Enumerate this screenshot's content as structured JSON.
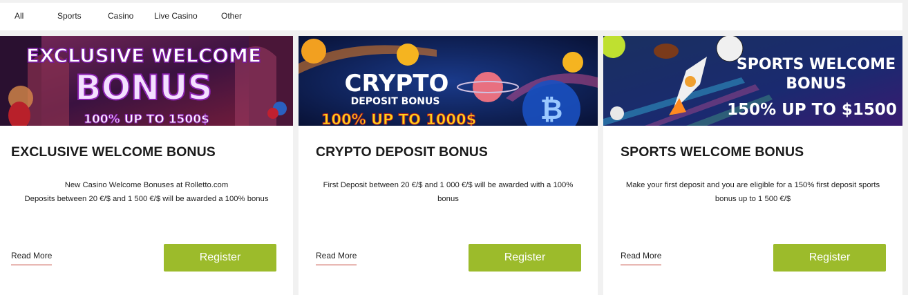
{
  "tabs": [
    {
      "label": "All"
    },
    {
      "label": "Sports"
    },
    {
      "label": "Casino"
    },
    {
      "label": "Live Casino"
    },
    {
      "label": "Other"
    }
  ],
  "cards": [
    {
      "banner": {
        "line1": "EXCLUSIVE WELCOME",
        "line2": "BONUS",
        "line3": "100% UP TO 1500$"
      },
      "title": "EXCLUSIVE WELCOME BONUS",
      "desc": [
        "New Casino Welcome Bonuses at Rolletto.com",
        "Deposits between 20 €/$ and 1 500 €/$ will be awarded a 100% bonus"
      ],
      "read_more": "Read More",
      "register": "Register"
    },
    {
      "banner": {
        "line1": "CRYPTO",
        "line2": "DEPOSIT BONUS",
        "line3": "100% UP TO 1000$"
      },
      "title": "CRYPTO DEPOSIT BONUS",
      "desc": [
        "First Deposit between 20 €/$ and 1 000 €/$ will be awarded with a 100%",
        "bonus"
      ],
      "read_more": "Read More",
      "register": "Register"
    },
    {
      "banner": {
        "line1": "SPORTS WELCOME",
        "line2": "BONUS",
        "line3": "150% UP TO $1500"
      },
      "title": "SPORTS WELCOME BONUS",
      "desc": [
        "Make your first deposit and you are eligible for a 150% first deposit sports",
        "bonus up to 1 500 €/$"
      ],
      "read_more": "Read More",
      "register": "Register"
    }
  ],
  "colors": {
    "register_bg": "#9cbb2b",
    "read_more_underline": "#c0392b",
    "banner1_bg": "#5a1a4a",
    "banner2_bg": "#0a1a4a",
    "banner3_bg": "#1a2a6a"
  }
}
